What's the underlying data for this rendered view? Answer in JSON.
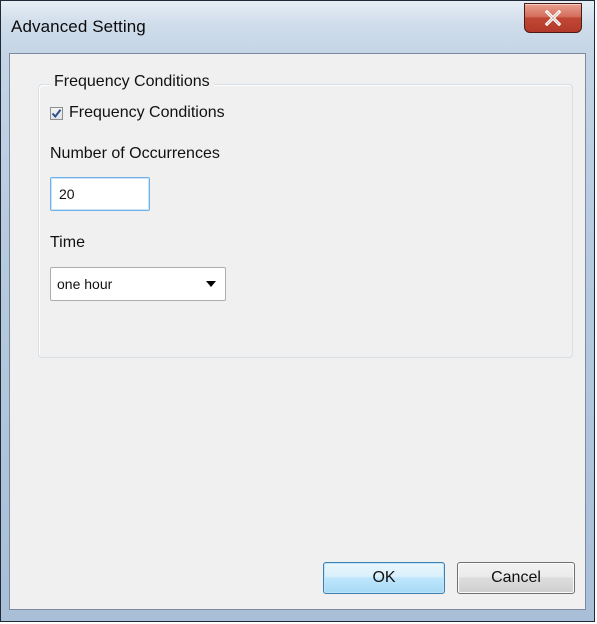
{
  "window": {
    "title": "Advanced Setting",
    "close_icon": "close-icon",
    "colors": {
      "frame": "#b8cbe0",
      "client": "#f0f0f0",
      "close_button": "#c04735",
      "focus_border": "#6fb1ea"
    }
  },
  "group": {
    "legend": "Frequency Conditions",
    "checkbox": {
      "label": "Frequency Conditions",
      "checked": true
    },
    "occurrences": {
      "label": "Number of Occurrences",
      "value": "20"
    },
    "time": {
      "label": "Time",
      "selected": "one hour"
    }
  },
  "buttons": {
    "ok_label": "OK",
    "cancel_label": "Cancel"
  }
}
